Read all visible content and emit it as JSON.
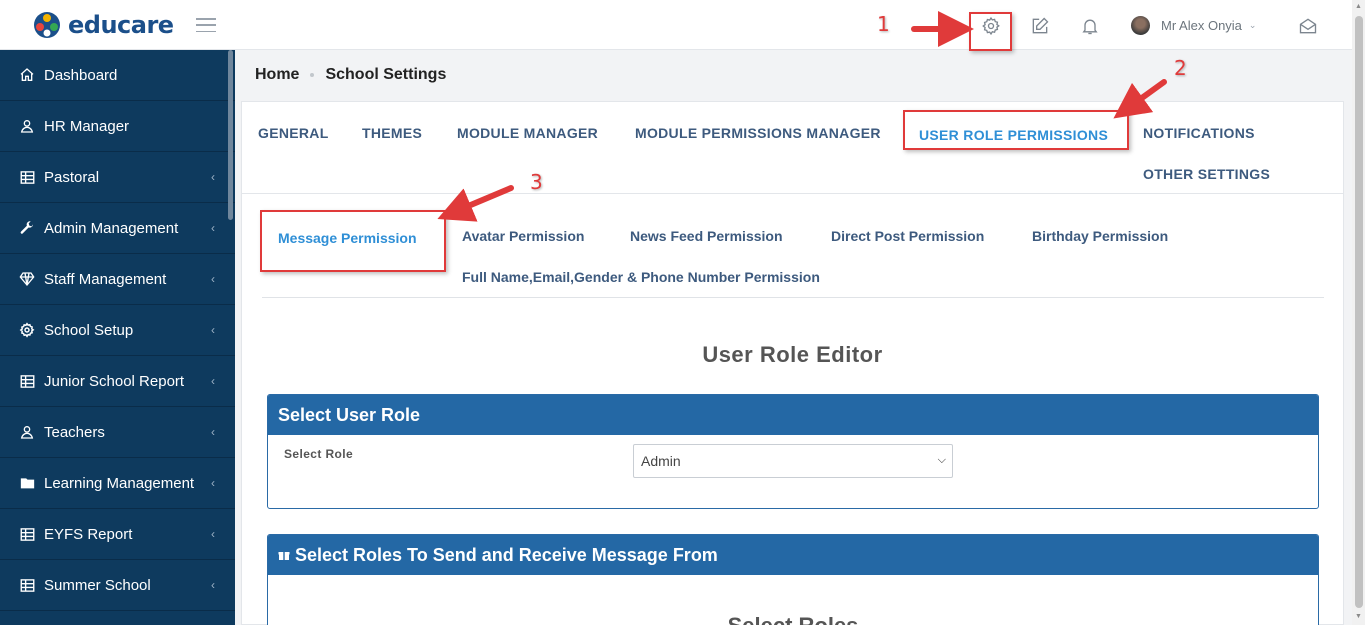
{
  "brand": {
    "name": "educare"
  },
  "topbar": {
    "icons": [
      "hamburger-icon",
      "gear-icon",
      "edit-icon",
      "bell-icon",
      "mail-open-icon"
    ],
    "user_name": "Mr Alex Onyia"
  },
  "sidebar": {
    "items": [
      {
        "label": "Dashboard",
        "icon": "home-icon",
        "expandable": false
      },
      {
        "label": "HR Manager",
        "icon": "user-icon",
        "expandable": false
      },
      {
        "label": "Pastoral",
        "icon": "table-icon",
        "expandable": true
      },
      {
        "label": "Admin Management",
        "icon": "wrench-icon",
        "expandable": true
      },
      {
        "label": "Staff Management",
        "icon": "diamond-icon",
        "expandable": true
      },
      {
        "label": "School Setup",
        "icon": "gear-icon",
        "expandable": true
      },
      {
        "label": "Junior School Report",
        "icon": "table-icon",
        "expandable": true
      },
      {
        "label": "Teachers",
        "icon": "user-icon",
        "expandable": true
      },
      {
        "label": "Learning Management",
        "icon": "folder-icon",
        "expandable": true
      },
      {
        "label": "EYFS Report",
        "icon": "table-icon",
        "expandable": true
      },
      {
        "label": "Summer School",
        "icon": "table-icon",
        "expandable": true
      }
    ]
  },
  "breadcrumb": {
    "home": "Home",
    "current": "School Settings"
  },
  "settings_tabs": [
    {
      "label": "GENERAL",
      "active": false
    },
    {
      "label": "THEMES",
      "active": false
    },
    {
      "label": "MODULE MANAGER",
      "active": false
    },
    {
      "label": "MODULE PERMISSIONS MANAGER",
      "active": false
    },
    {
      "label": "USER ROLE PERMISSIONS",
      "active": true
    },
    {
      "label": "NOTIFICATIONS",
      "active": false
    },
    {
      "label": "OTHER SETTINGS",
      "active": false
    }
  ],
  "permission_tabs": [
    {
      "label": "Message Permission",
      "active": true
    },
    {
      "label": "Avatar Permission",
      "active": false
    },
    {
      "label": "News Feed Permission",
      "active": false
    },
    {
      "label": "Direct Post Permission",
      "active": false
    },
    {
      "label": "Birthday Permission",
      "active": false
    },
    {
      "label": "Full Name,Email,Gender & Phone Number Permission",
      "active": false
    }
  ],
  "editor": {
    "title": "User Role Editor",
    "select_user_role_heading": "Select User Role",
    "select_role_label": "Select Role",
    "select_role_value": "Admin",
    "send_receive_heading": "Select Roles To Send and Receive Message From",
    "select_roles_title": "Select Roles"
  },
  "annotations": {
    "numbers": [
      "1",
      "2",
      "3"
    ],
    "color": "#e03a3a"
  },
  "colors": {
    "sidebar_bg": "#0e3a5e",
    "panel_header": "#2468a5",
    "active_tab": "#2f8fd6",
    "tab_text": "#3d5a7e"
  }
}
